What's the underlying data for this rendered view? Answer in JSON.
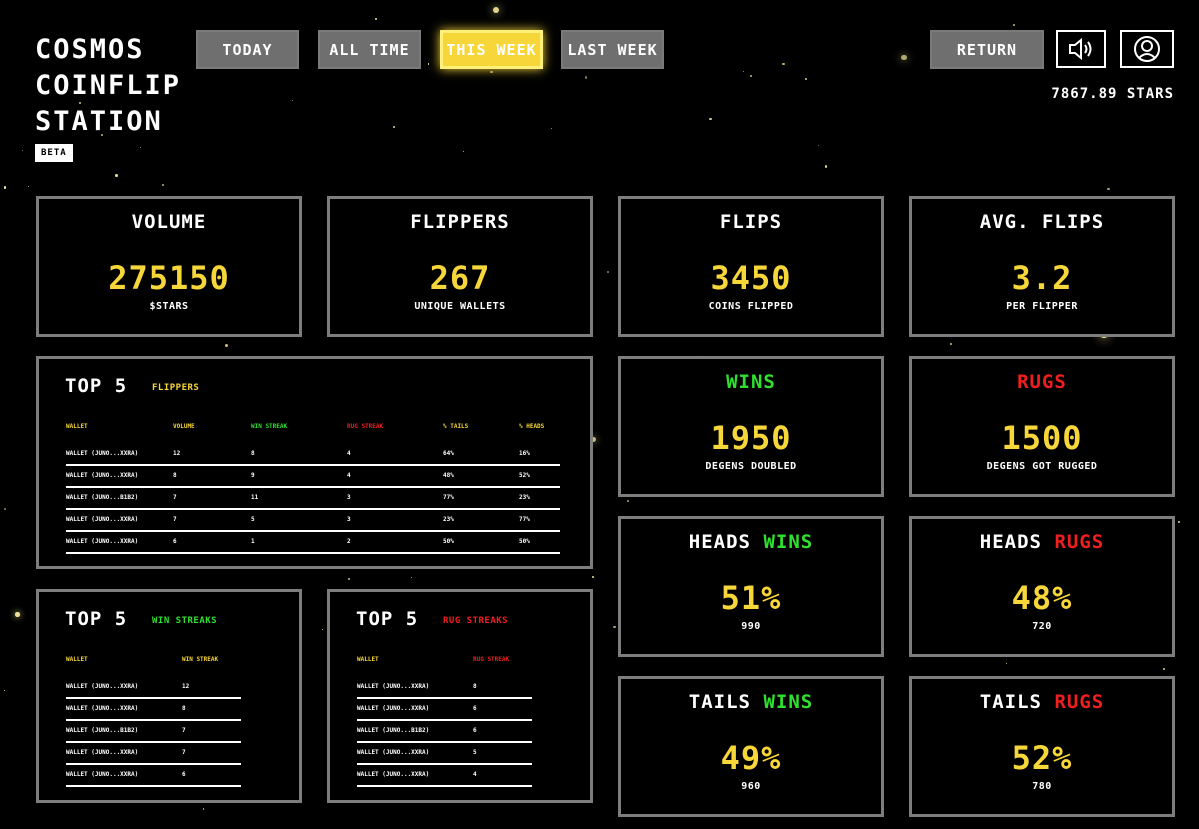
{
  "logo": {
    "line1": "COSMOS",
    "line2": "COINFLIP",
    "line3": "STATION",
    "badge": "BETA"
  },
  "tabs": {
    "today": "TODAY",
    "all_time": "ALL TIME",
    "this_week": "THIS WEEK",
    "last_week": "LAST WEEK",
    "active": "this_week"
  },
  "header": {
    "return_label": "RETURN",
    "balance": "7867.89 STARS"
  },
  "icons": {
    "sound": "speaker-icon",
    "profile": "user-avatar-icon"
  },
  "colors": {
    "accent": "#f7d63a",
    "win": "#2fe02f",
    "rug": "#f01e1e",
    "border": "#7d7d7d"
  },
  "stats": {
    "volume": {
      "title": "VOLUME",
      "value": "275150",
      "sub": "$STARS"
    },
    "flippers": {
      "title": "FLIPPERS",
      "value": "267",
      "sub": "UNIQUE WALLETS"
    },
    "flips": {
      "title": "FLIPS",
      "value": "3450",
      "sub": "COINS FLIPPED"
    },
    "avg_flips": {
      "title": "AVG. FLIPS",
      "value": "3.2",
      "sub": "PER FLIPPER"
    },
    "wins": {
      "title": "WINS",
      "value": "1950",
      "sub": "DEGENS DOUBLED"
    },
    "rugs": {
      "title": "RUGS",
      "value": "1500",
      "sub": "DEGENS GOT RUGGED"
    },
    "heads_wins": {
      "title_a": "HEADS",
      "title_b": "WINS",
      "value": "51%",
      "sub": "990"
    },
    "heads_rugs": {
      "title_a": "HEADS",
      "title_b": "RUGS",
      "value": "48%",
      "sub": "720"
    },
    "tails_wins": {
      "title_a": "TAILS",
      "title_b": "WINS",
      "value": "49%",
      "sub": "960"
    },
    "tails_rugs": {
      "title_a": "TAILS",
      "title_b": "RUGS",
      "value": "52%",
      "sub": "780"
    }
  },
  "top_flippers": {
    "title": "TOP 5",
    "subtitle": "FLIPPERS",
    "columns": [
      "WALLET",
      "VOLUME",
      "WIN STREAK",
      "RUG STREAK",
      "% TAILS",
      "% HEADS"
    ],
    "rows": [
      [
        "WALLET (JUNO...XXRA)",
        "12",
        "8",
        "4",
        "64%",
        "16%"
      ],
      [
        "WALLET (JUNO...XXRA)",
        "8",
        "9",
        "4",
        "48%",
        "52%"
      ],
      [
        "WALLET (JUNO...B1B2)",
        "7",
        "11",
        "3",
        "77%",
        "23%"
      ],
      [
        "WALLET (JUNO...XXRA)",
        "7",
        "5",
        "3",
        "23%",
        "77%"
      ],
      [
        "WALLET (JUNO...XXRA)",
        "6",
        "1",
        "2",
        "50%",
        "50%"
      ]
    ]
  },
  "top_win_streaks": {
    "title": "TOP 5",
    "subtitle": "WIN STREAKS",
    "columns": [
      "WALLET",
      "WIN STREAK"
    ],
    "rows": [
      [
        "WALLET (JUNO...XXRA)",
        "12"
      ],
      [
        "WALLET (JUNO...XXRA)",
        "8"
      ],
      [
        "WALLET (JUNO...B1B2)",
        "7"
      ],
      [
        "WALLET (JUNO...XXRA)",
        "7"
      ],
      [
        "WALLET (JUNO...XXRA)",
        "6"
      ]
    ]
  },
  "top_rug_streaks": {
    "title": "TOP 5",
    "subtitle": "RUG STREAKS",
    "columns": [
      "WALLET",
      "RUG STREAK"
    ],
    "rows": [
      [
        "WALLET (JUNO...XXRA)",
        "8"
      ],
      [
        "WALLET (JUNO...XXRA)",
        "6"
      ],
      [
        "WALLET (JUNO...B1B2)",
        "6"
      ],
      [
        "WALLET (JUNO...XXRA)",
        "5"
      ],
      [
        "WALLET (JUNO...XXRA)",
        "4"
      ]
    ]
  }
}
